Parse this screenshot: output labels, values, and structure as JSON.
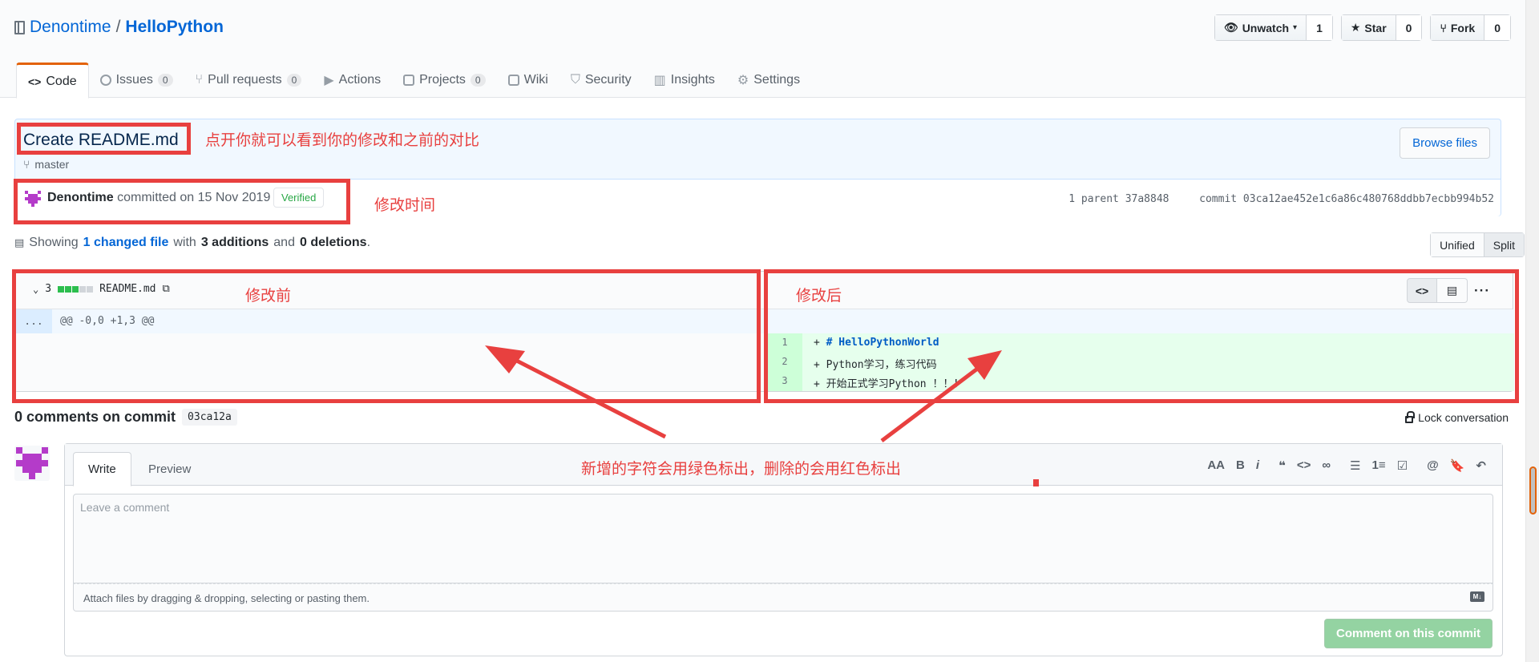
{
  "repo": {
    "owner": "Denontime",
    "separator": "/",
    "name": "HelloPython"
  },
  "actions": [
    {
      "label": "Unwatch",
      "count": "1",
      "icon": "eye-icon"
    },
    {
      "label": "Star",
      "count": "0",
      "icon": "star-icon"
    },
    {
      "label": "Fork",
      "count": "0",
      "icon": "fork-icon"
    }
  ],
  "tabs": [
    {
      "label": "Code",
      "icon": "code-icon",
      "selected": true
    },
    {
      "label": "Issues",
      "counter": "0",
      "icon": "issue-icon"
    },
    {
      "label": "Pull requests",
      "counter": "0",
      "icon": "pull-request-icon"
    },
    {
      "label": "Actions",
      "icon": "play-icon"
    },
    {
      "label": "Projects",
      "counter": "0",
      "icon": "project-icon"
    },
    {
      "label": "Wiki",
      "icon": "book-icon"
    },
    {
      "label": "Security",
      "icon": "shield-icon"
    },
    {
      "label": "Insights",
      "icon": "graph-icon"
    },
    {
      "label": "Settings",
      "icon": "gear-icon"
    }
  ],
  "commit": {
    "title": "Create README.md",
    "branch": "master",
    "browse_files": "Browse files",
    "author": "Denontime",
    "committed_text": "committed on 15 Nov 2019",
    "verified": "Verified",
    "parent_info": "1 parent 37a8848",
    "sha_info": "commit 03ca12ae452e1c6a86c480768ddbb7ecbb994b52"
  },
  "toc": {
    "showing": "Showing",
    "changed": "1 changed file",
    "with": "with",
    "additions": "3 additions",
    "and": "and",
    "deletions": "0 deletions",
    "period": "."
  },
  "diff_view": {
    "unified": "Unified",
    "split": "Split"
  },
  "file": {
    "changes": "3",
    "name": "README.md",
    "hunk_marker": "...",
    "hunk_header": "@@ -0,0 +1,3 @@",
    "lines": [
      {
        "num": "1",
        "prefix": "+ ",
        "text": "# HelloPythonWorld"
      },
      {
        "num": "2",
        "prefix": "+ ",
        "text": "Python学习，练习代码"
      },
      {
        "num": "3",
        "prefix": "+ ",
        "text": "开始正式学习Python ！！！"
      }
    ],
    "more": "···"
  },
  "comments": {
    "title": "0 comments on commit",
    "sha": "03ca12a",
    "lock": "Lock conversation",
    "write_tab": "Write",
    "preview_tab": "Preview",
    "toolbar": [
      "AA",
      "B",
      "i",
      "❝",
      "<>",
      "∞",
      "☰",
      "1≡",
      "☑",
      "@",
      "🔖",
      "↶"
    ],
    "placeholder": "Leave a comment",
    "attach": "Attach files by dragging & dropping, selecting or pasting them.",
    "md_badge": "M↓",
    "submit": "Comment on this commit"
  },
  "annotations": {
    "compare_note": "点开你就可以看到你的修改和之前的对比",
    "time_note": "修改时间",
    "before_note": "修改前",
    "after_note": "修改后",
    "color_note": "新增的字符会用绿色标出，删除的会用红色标出"
  },
  "colors": {
    "accent": "#0366d6",
    "annotation": "#e8403f",
    "tab_active": "#e36209",
    "added_bg": "#e6ffed",
    "submit": "#94d3a2"
  }
}
